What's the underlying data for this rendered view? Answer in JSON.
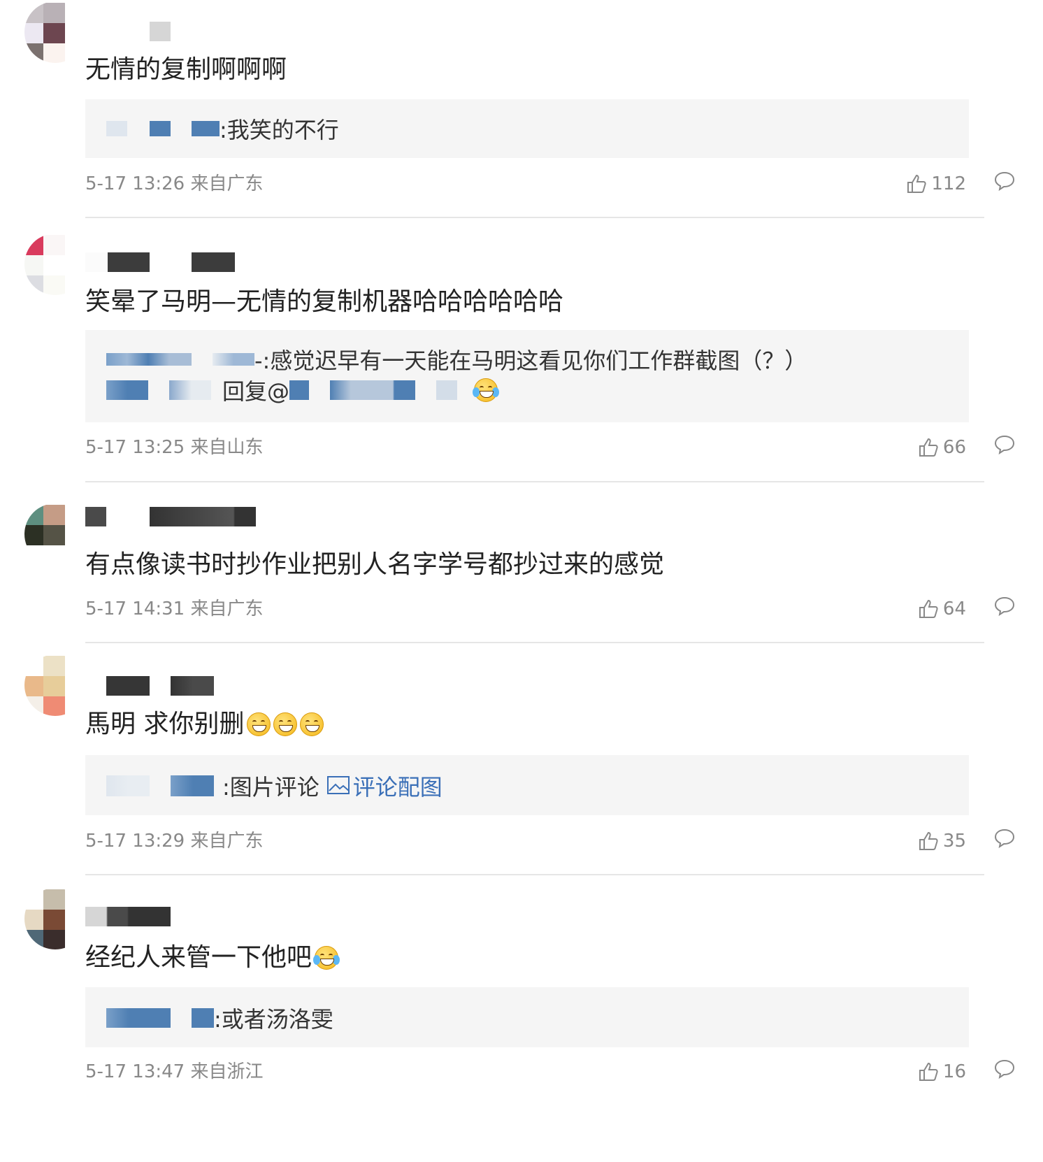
{
  "comments": [
    {
      "text": "无情的复制啊啊啊",
      "reply_pre": ":我笑的不行",
      "reply_line2": "",
      "timestamp": "5-17 13:26 来自广东",
      "likes": "112"
    },
    {
      "text": "笑晕了马明—无情的复制机器哈哈哈哈哈哈",
      "reply_pre": "-:感觉迟早有一天能在马明这看见你们工作群截图（？）",
      "reply_line2": "回复@",
      "timestamp": "5-17 13:25 来自山东",
      "likes": "66"
    },
    {
      "text": "有点像读书时抄作业把别人名字学号都抄过来的感觉",
      "timestamp": "5-17 14:31 来自广东",
      "likes": "64"
    },
    {
      "text": "馬明 求你别删",
      "reply_pre": ":图片评论",
      "reply_link": "评论配图",
      "timestamp": "5-17 13:29 来自广东",
      "likes": "35"
    },
    {
      "text": "经纪人来管一下他吧",
      "reply_pre": ":或者汤洛雯",
      "timestamp": "5-17 13:47 来自浙江",
      "likes": "16"
    }
  ],
  "icons": {
    "like": "thumbs-up-icon",
    "reply": "speech-bubble-icon",
    "emoji_grin": "grin-emoji-icon",
    "emoji_cry": "laugh-cry-emoji-icon",
    "picture": "picture-icon"
  },
  "colors": {
    "text": "#222222",
    "meta": "#888888",
    "reply_bg": "#f5f5f5",
    "divider": "#e6e6e6",
    "link": "#3a6fb7"
  }
}
